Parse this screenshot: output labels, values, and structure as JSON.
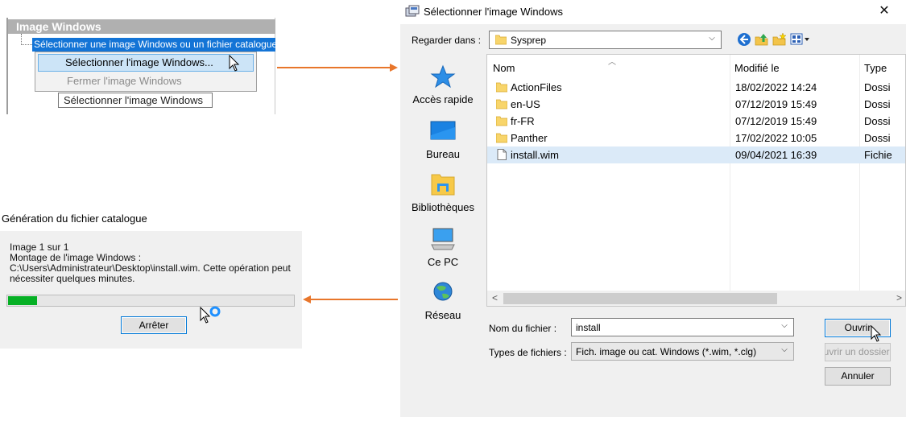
{
  "context_panel": {
    "header": "Image Windows",
    "tree_item": "Sélectionner une image Windows ou un fichier catalogue",
    "menu_items": [
      "Sélectionner l'image Windows...",
      "Fermer l'image Windows"
    ],
    "tooltip": "Sélectionner l'image Windows"
  },
  "progress_dialog": {
    "title": "Génération du fichier catalogue",
    "message": "Image 1 sur 1\nMontage de l'image Windows :\nC:\\Users\\Administrateur\\Desktop\\install.wim. Cette opération peut nécessiter quelques minutes.",
    "progress": 0.1,
    "stop_label": "Arrêter"
  },
  "open_dialog": {
    "title": "Sélectionner l'image Windows",
    "close_glyph": "✕",
    "look_in_label": "Regarder dans :",
    "look_in_value": "Sysprep",
    "places": [
      "Accès rapide",
      "Bureau",
      "Bibliothèques",
      "Ce PC",
      "Réseau"
    ],
    "columns": [
      "Nom",
      "Modifié le",
      "Type"
    ],
    "files": [
      {
        "name": "ActionFiles",
        "date": "18/02/2022 14:24",
        "type": "Dossi",
        "kind": "folder"
      },
      {
        "name": "en-US",
        "date": "07/12/2019 15:49",
        "type": "Dossi",
        "kind": "folder"
      },
      {
        "name": "fr-FR",
        "date": "07/12/2019 15:49",
        "type": "Dossi",
        "kind": "folder"
      },
      {
        "name": "Panther",
        "date": "17/02/2022 10:05",
        "type": "Dossi",
        "kind": "folder"
      },
      {
        "name": "install.wim",
        "date": "09/04/2021 16:39",
        "type": "Fichie",
        "kind": "file",
        "selected": true
      }
    ],
    "file_name_label": "Nom du fichier :",
    "file_name_value": "install",
    "file_type_label": "Types de fichiers :",
    "file_type_value": "Fich. image ou cat. Windows (*.wim, *.clg)",
    "open_label": "Ouvrir",
    "open_folder_label": "Ouvrir un dossier",
    "cancel_label": "Annuler"
  },
  "colors": {
    "accent": "#e8762b",
    "selection": "#1374d6",
    "progress": "#06b025"
  }
}
